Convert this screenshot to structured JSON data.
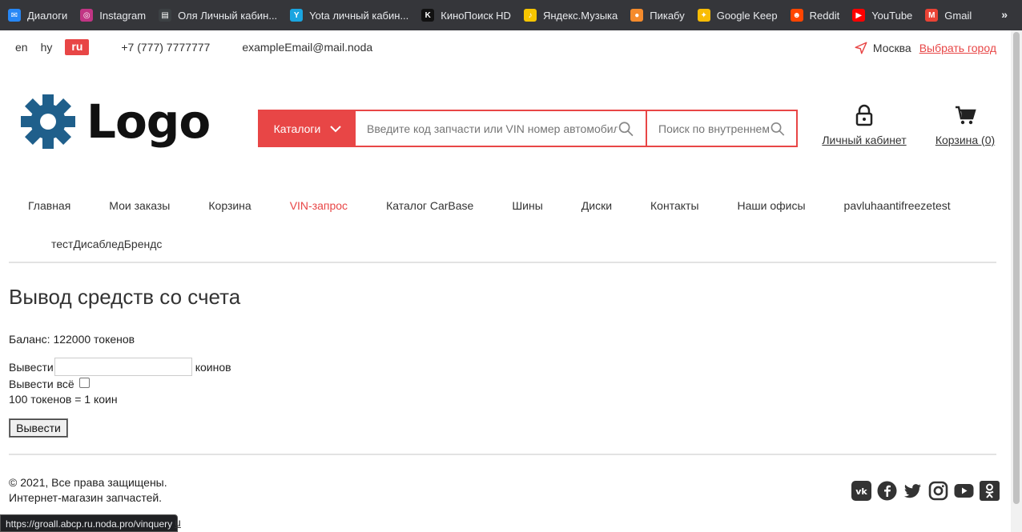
{
  "bookmarks": [
    {
      "label": "Диалоги",
      "icon": "chat-icon",
      "color": "#2787f5"
    },
    {
      "label": "Instagram",
      "icon": "instagram-icon",
      "color": "#c13584"
    },
    {
      "label": "Оля Личный кабин...",
      "icon": "page-icon",
      "color": "#3c4043"
    },
    {
      "label": "Yota личный кабин...",
      "icon": "yota-icon",
      "color": "#1aa5e0"
    },
    {
      "label": "КиноПоиск HD",
      "icon": "kinopoisk-icon",
      "color": "#111111"
    },
    {
      "label": "Яндекс.Музыка",
      "icon": "yandex-music-icon",
      "color": "#f7c600"
    },
    {
      "label": "Пикабу",
      "icon": "pikabu-icon",
      "color": "#f58b2c"
    },
    {
      "label": "Google Keep",
      "icon": "keep-icon",
      "color": "#f9bc05"
    },
    {
      "label": "Reddit",
      "icon": "reddit-icon",
      "color": "#ff4500"
    },
    {
      "label": "YouTube",
      "icon": "youtube-icon",
      "color": "#ff0000"
    },
    {
      "label": "Gmail",
      "icon": "gmail-icon",
      "color": "#ea4335"
    }
  ],
  "bookmarks_more": "»",
  "topbar": {
    "langs": [
      "en",
      "hy",
      "ru"
    ],
    "active_lang": "ru",
    "phone": "+7 (777) 7777777",
    "email": "exampleEmail@mail.noda",
    "city": "Москва",
    "choose_city": "Выбрать город"
  },
  "header": {
    "logo_text": "Logo",
    "catalog_label": "Каталоги",
    "search_placeholder": "Введите код запчасти или VIN номер автомобиля",
    "inner_search_placeholder": "Поиск по внутреннему каталогу",
    "account_label": "Личный кабинет",
    "cart_label": "Корзина (0)"
  },
  "nav": {
    "row1": [
      "Главная",
      "Мои заказы",
      "Корзина",
      "VIN-запрос",
      "Каталог CarBase",
      "Шины",
      "Диски",
      "Контакты",
      "Наши офисы",
      "pavluhaantifreezetest"
    ],
    "row2": [
      "тестДисабледБрендс"
    ],
    "active": "VIN-запрос"
  },
  "main": {
    "title": "Вывод средств со счета",
    "balance": "Баланс: 122000 токенов",
    "withdraw_label": "Вывести",
    "withdraw_unit": "коинов",
    "withdraw_all_label": "Вывести всё",
    "rate": "100 токенов = 1 коин",
    "submit": "Вывести"
  },
  "footer": {
    "copyright": "© 2021, Все права защищены.",
    "tagline": "Интернет-магазин запчастей.",
    "socials": [
      "vk-icon",
      "facebook-icon",
      "twitter-icon",
      "instagram-icon",
      "youtube-icon",
      "odnoklassniki-icon"
    ],
    "trailing_link": "u"
  },
  "status_bar": {
    "url": "https://groall.abcp.ru.noda.pro/vinquery"
  },
  "colors": {
    "accent": "#e84646",
    "social": "#333333"
  }
}
